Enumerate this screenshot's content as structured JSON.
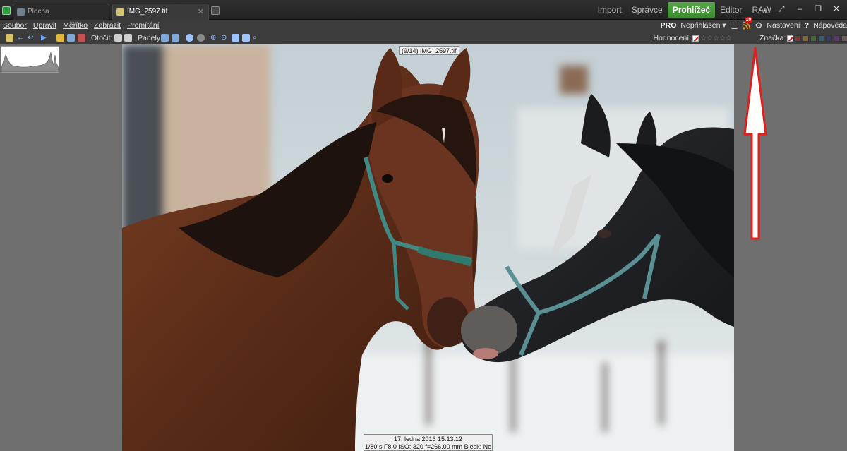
{
  "tabs": [
    {
      "label": "Plocha",
      "active": false
    },
    {
      "label": "IMG_2597.tif",
      "active": true
    }
  ],
  "modes": [
    "Import",
    "Správce",
    "Prohlížeč",
    "Editor",
    "RAW"
  ],
  "active_mode": "Prohlížeč",
  "window_buttons": {
    "minimize": "–",
    "restore": "❐",
    "close": "✕"
  },
  "menu": [
    "Soubor",
    "Upravit",
    "Měřítko",
    "Zobrazit",
    "Promítání"
  ],
  "right_menu": {
    "pro": "PRO",
    "login": "Nepřihlášen",
    "rss_badge": "10",
    "settings": "Nastavení",
    "help_mark": "?",
    "help": "Nápověda"
  },
  "toolbar": {
    "rotate_label": "Otočit:",
    "panels_label": "Panely:",
    "rating_label": "Hodnocení:",
    "rating_value": 0,
    "rating_max": 5,
    "tag_label": "Značka:",
    "tag_colors": [
      "#7a3a3a",
      "#7a6a3a",
      "#4a6a3a",
      "#3a5a6a",
      "#3a3a6a",
      "#5a3a6a",
      "#6a5a5a",
      "#5a5a5a"
    ]
  },
  "viewer": {
    "title_tip": "(9/14) IMG_2597.tif",
    "info_line1": "17. ledna 2016 15:13:12",
    "info_line2": "1/80 s F8.0 ISO: 320 f=266.00 mm Blesk: Ne"
  },
  "colors": {
    "accent_green": "#4a9a3c",
    "arrow_red": "#e01e1e",
    "badge_red": "#d01a1a"
  }
}
